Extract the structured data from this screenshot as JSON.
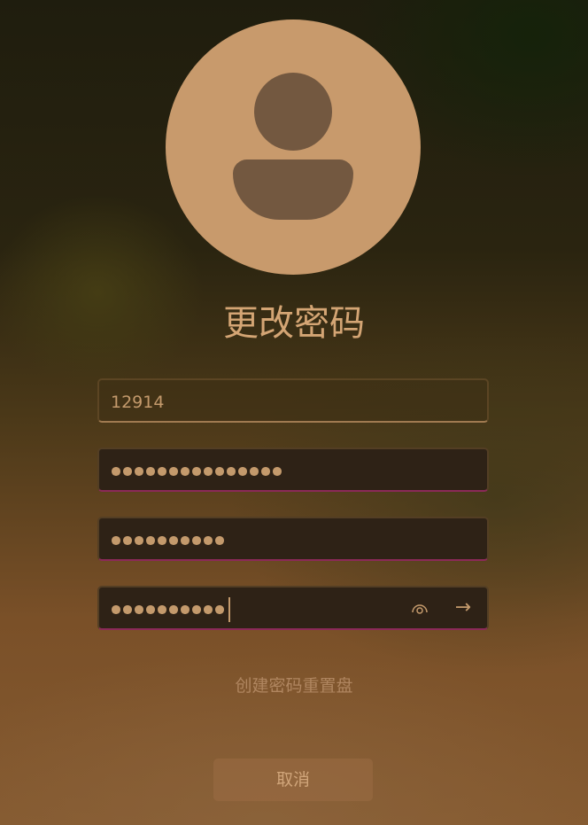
{
  "title": "更改密码",
  "username": "12914",
  "old_password_length": 15,
  "new_password_length": 10,
  "confirm_password_length": 10,
  "reset_disk_link": "创建密码重置盘",
  "cancel_label": "取消",
  "eye_icon": "👁",
  "arrow_icon": "→"
}
